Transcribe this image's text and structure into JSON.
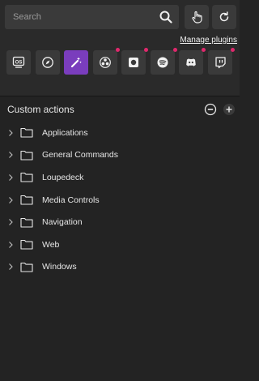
{
  "search": {
    "placeholder": "Search"
  },
  "header": {
    "manage_plugins": "Manage plugins"
  },
  "plugins": [
    {
      "name": "windows-os-plugin",
      "badge": "OS",
      "active": false,
      "dot": false
    },
    {
      "name": "navigation-plugin",
      "active": false,
      "dot": false
    },
    {
      "name": "loupedeck-plugin",
      "active": true,
      "dot": false
    },
    {
      "name": "obs-plugin",
      "active": false,
      "dot": true
    },
    {
      "name": "camera-plugin",
      "active": false,
      "dot": true
    },
    {
      "name": "spotify-plugin",
      "active": false,
      "dot": true
    },
    {
      "name": "discord-plugin",
      "active": false,
      "dot": true
    },
    {
      "name": "twitch-plugin",
      "active": false,
      "dot": true
    }
  ],
  "custom_actions": {
    "title": "Custom actions",
    "folders": [
      {
        "label": "Applications"
      },
      {
        "label": "General Commands"
      },
      {
        "label": "Loupedeck"
      },
      {
        "label": "Media Controls"
      },
      {
        "label": "Navigation"
      },
      {
        "label": "Web"
      },
      {
        "label": "Windows"
      }
    ]
  },
  "colors": {
    "accent": "#7a3dbd",
    "notification_dot": "#e0286d",
    "background": "#232323"
  }
}
